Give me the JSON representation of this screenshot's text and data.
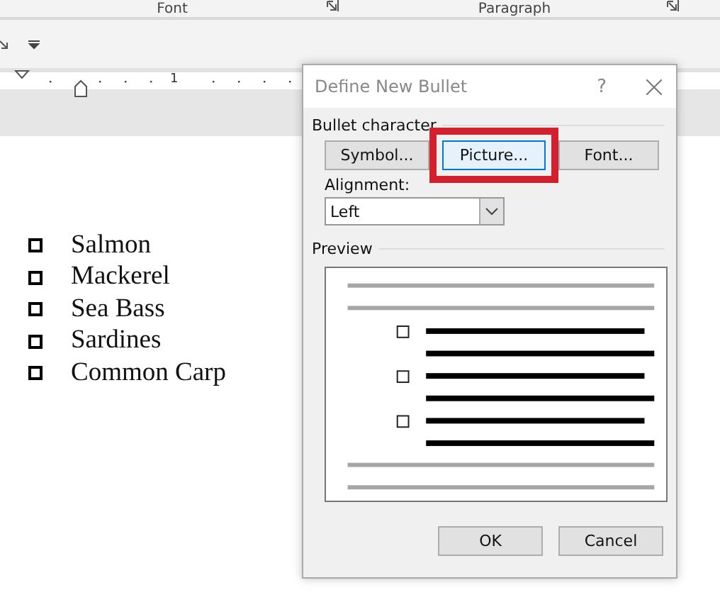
{
  "ribbon": {
    "groups": [
      {
        "label": "Font"
      },
      {
        "label": "Paragraph"
      }
    ]
  },
  "document": {
    "list": [
      {
        "text": "Salmon"
      },
      {
        "text": "Mackerel"
      },
      {
        "text": "Sea Bass"
      },
      {
        "text": "Sardines"
      },
      {
        "text": "Common Carp"
      }
    ]
  },
  "ruler": {
    "mark": "1"
  },
  "dialog": {
    "title": "Define New Bullet",
    "help": "?",
    "section": "Bullet character",
    "buttons": [
      {
        "label": "Symbol...",
        "focused": false,
        "highlighted": false
      },
      {
        "label": "Picture...",
        "focused": true,
        "highlighted": true
      },
      {
        "label": "Font...",
        "focused": false,
        "highlighted": false
      }
    ],
    "alignment": {
      "label": "Alignment:",
      "value": "Left"
    },
    "preview": {
      "label": "Preview"
    },
    "actions": [
      "OK",
      "Cancel"
    ]
  }
}
